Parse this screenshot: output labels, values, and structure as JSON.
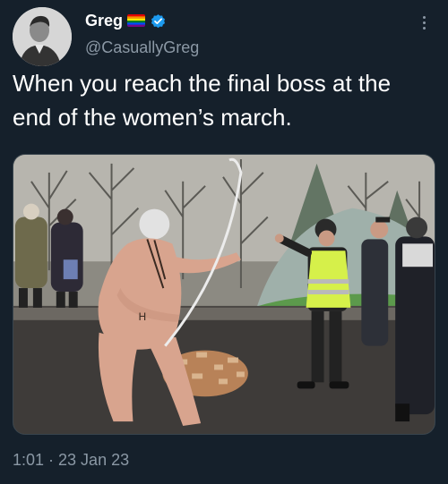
{
  "tweet": {
    "display_name": "Greg",
    "handle": "@CasuallyGreg",
    "text": "When you reach the final boss at the end of the women’s march.",
    "timestamp": "1:01 · 23 Jan 23",
    "icons": {
      "flag": "rainbow-flag-icon",
      "verified": "verified-badge-icon",
      "more": "more-options-icon"
    },
    "colors": {
      "background": "#15202b",
      "secondary_text": "#8b98a5",
      "verified_blue": "#1d9bf0"
    }
  }
}
